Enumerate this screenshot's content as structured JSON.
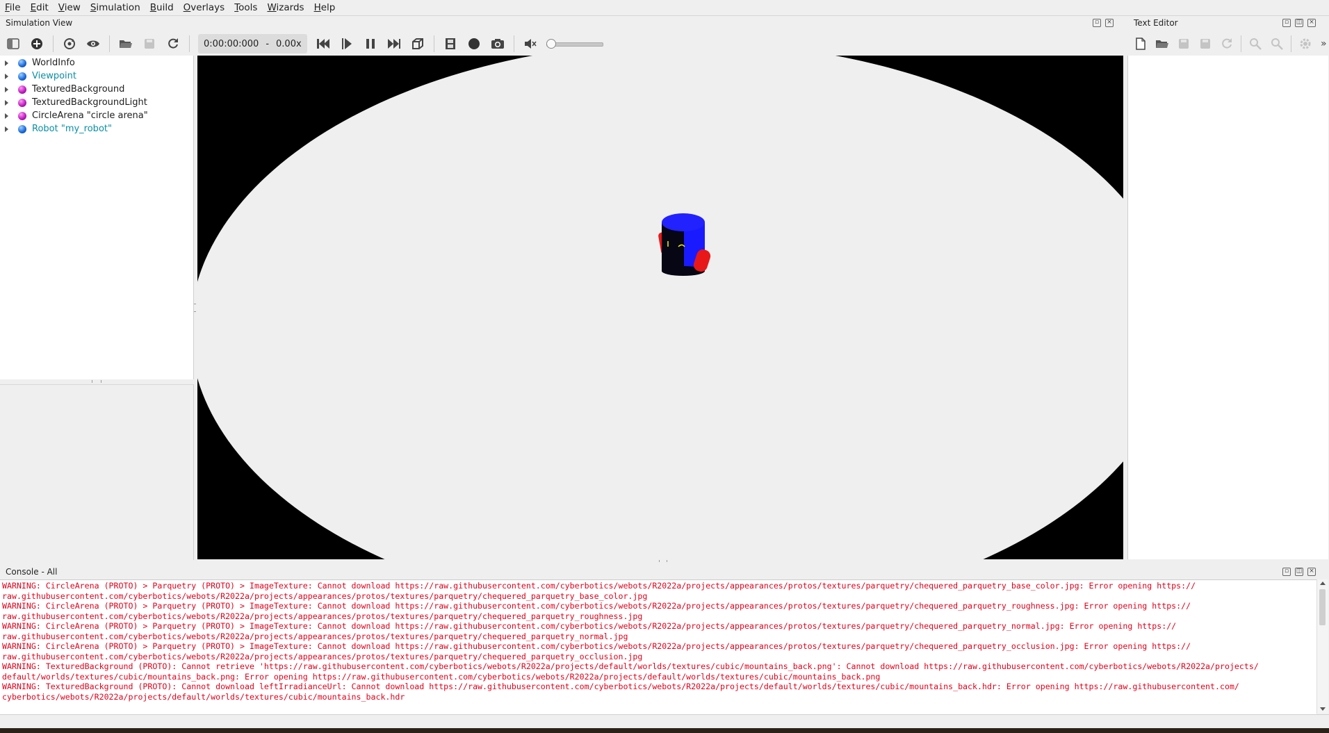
{
  "menu": [
    {
      "label": "File",
      "mnemonic": "F",
      "rest": "ile"
    },
    {
      "label": "Edit",
      "mnemonic": "E",
      "rest": "dit"
    },
    {
      "label": "View",
      "mnemonic": "V",
      "rest": "iew"
    },
    {
      "label": "Simulation",
      "mnemonic": "S",
      "rest": "imulation"
    },
    {
      "label": "Build",
      "mnemonic": "B",
      "rest": "uild"
    },
    {
      "label": "Overlays",
      "mnemonic": "O",
      "rest": "verlays"
    },
    {
      "label": "Tools",
      "mnemonic": "T",
      "rest": "ools"
    },
    {
      "label": "Wizards",
      "mnemonic": "W",
      "rest": "izards"
    },
    {
      "label": "Help",
      "mnemonic": "H",
      "rest": "elp"
    }
  ],
  "simulation_view": {
    "title": "Simulation View",
    "time": "0:00:00:000",
    "separator": "-",
    "speed": "0.00x",
    "volume": 0
  },
  "text_editor": {
    "title": "Text Editor",
    "more": "»"
  },
  "scene_tree": [
    {
      "label": "WorldInfo",
      "ball": "blue",
      "highlight": false
    },
    {
      "label": "Viewpoint",
      "ball": "blue",
      "highlight": true
    },
    {
      "label": "TexturedBackground",
      "ball": "purple",
      "highlight": false
    },
    {
      "label": "TexturedBackgroundLight",
      "ball": "purple",
      "highlight": false
    },
    {
      "label": "CircleArena \"circle arena\"",
      "ball": "purple",
      "highlight": false
    },
    {
      "label": "Robot \"my_robot\"",
      "ball": "blue",
      "highlight": true
    }
  ],
  "console": {
    "title": "Console - All",
    "lines": [
      "WARNING: CircleArena (PROTO) > Parquetry (PROTO) > ImageTexture: Cannot download https://raw.githubusercontent.com/cyberbotics/webots/R2022a/projects/appearances/protos/textures/parquetry/chequered_parquetry_base_color.jpg: Error opening https://",
      "raw.githubusercontent.com/cyberbotics/webots/R2022a/projects/appearances/protos/textures/parquetry/chequered_parquetry_base_color.jpg",
      "WARNING: CircleArena (PROTO) > Parquetry (PROTO) > ImageTexture: Cannot download https://raw.githubusercontent.com/cyberbotics/webots/R2022a/projects/appearances/protos/textures/parquetry/chequered_parquetry_roughness.jpg: Error opening https://",
      "raw.githubusercontent.com/cyberbotics/webots/R2022a/projects/appearances/protos/textures/parquetry/chequered_parquetry_roughness.jpg",
      "WARNING: CircleArena (PROTO) > Parquetry (PROTO) > ImageTexture: Cannot download https://raw.githubusercontent.com/cyberbotics/webots/R2022a/projects/appearances/protos/textures/parquetry/chequered_parquetry_normal.jpg: Error opening https://",
      "raw.githubusercontent.com/cyberbotics/webots/R2022a/projects/appearances/protos/textures/parquetry/chequered_parquetry_normal.jpg",
      "WARNING: CircleArena (PROTO) > Parquetry (PROTO) > ImageTexture: Cannot download https://raw.githubusercontent.com/cyberbotics/webots/R2022a/projects/appearances/protos/textures/parquetry/chequered_parquetry_occlusion.jpg: Error opening https://",
      "raw.githubusercontent.com/cyberbotics/webots/R2022a/projects/appearances/protos/textures/parquetry/chequered_parquetry_occlusion.jpg",
      "WARNING: TexturedBackground (PROTO): Cannot retrieve 'https://raw.githubusercontent.com/cyberbotics/webots/R2022a/projects/default/worlds/textures/cubic/mountains_back.png': Cannot download https://raw.githubusercontent.com/cyberbotics/webots/R2022a/projects/",
      "default/worlds/textures/cubic/mountains_back.png: Error opening https://raw.githubusercontent.com/cyberbotics/webots/R2022a/projects/default/worlds/textures/cubic/mountains_back.png",
      "WARNING: TexturedBackground (PROTO): Cannot download leftIrradianceUrl: Cannot download https://raw.githubusercontent.com/cyberbotics/webots/R2022a/projects/default/worlds/textures/cubic/mountains_back.hdr: Error opening https://raw.githubusercontent.com/",
      "cyberbotics/webots/R2022a/projects/default/worlds/textures/cubic/mountains_back.hdr"
    ]
  },
  "colors": {
    "warning_text": "#e1001a",
    "highlight_node": "#0a8fa5",
    "arena_floor": "#efefef",
    "robot_body": "#1a1aff",
    "robot_wheels": "#e81818"
  }
}
